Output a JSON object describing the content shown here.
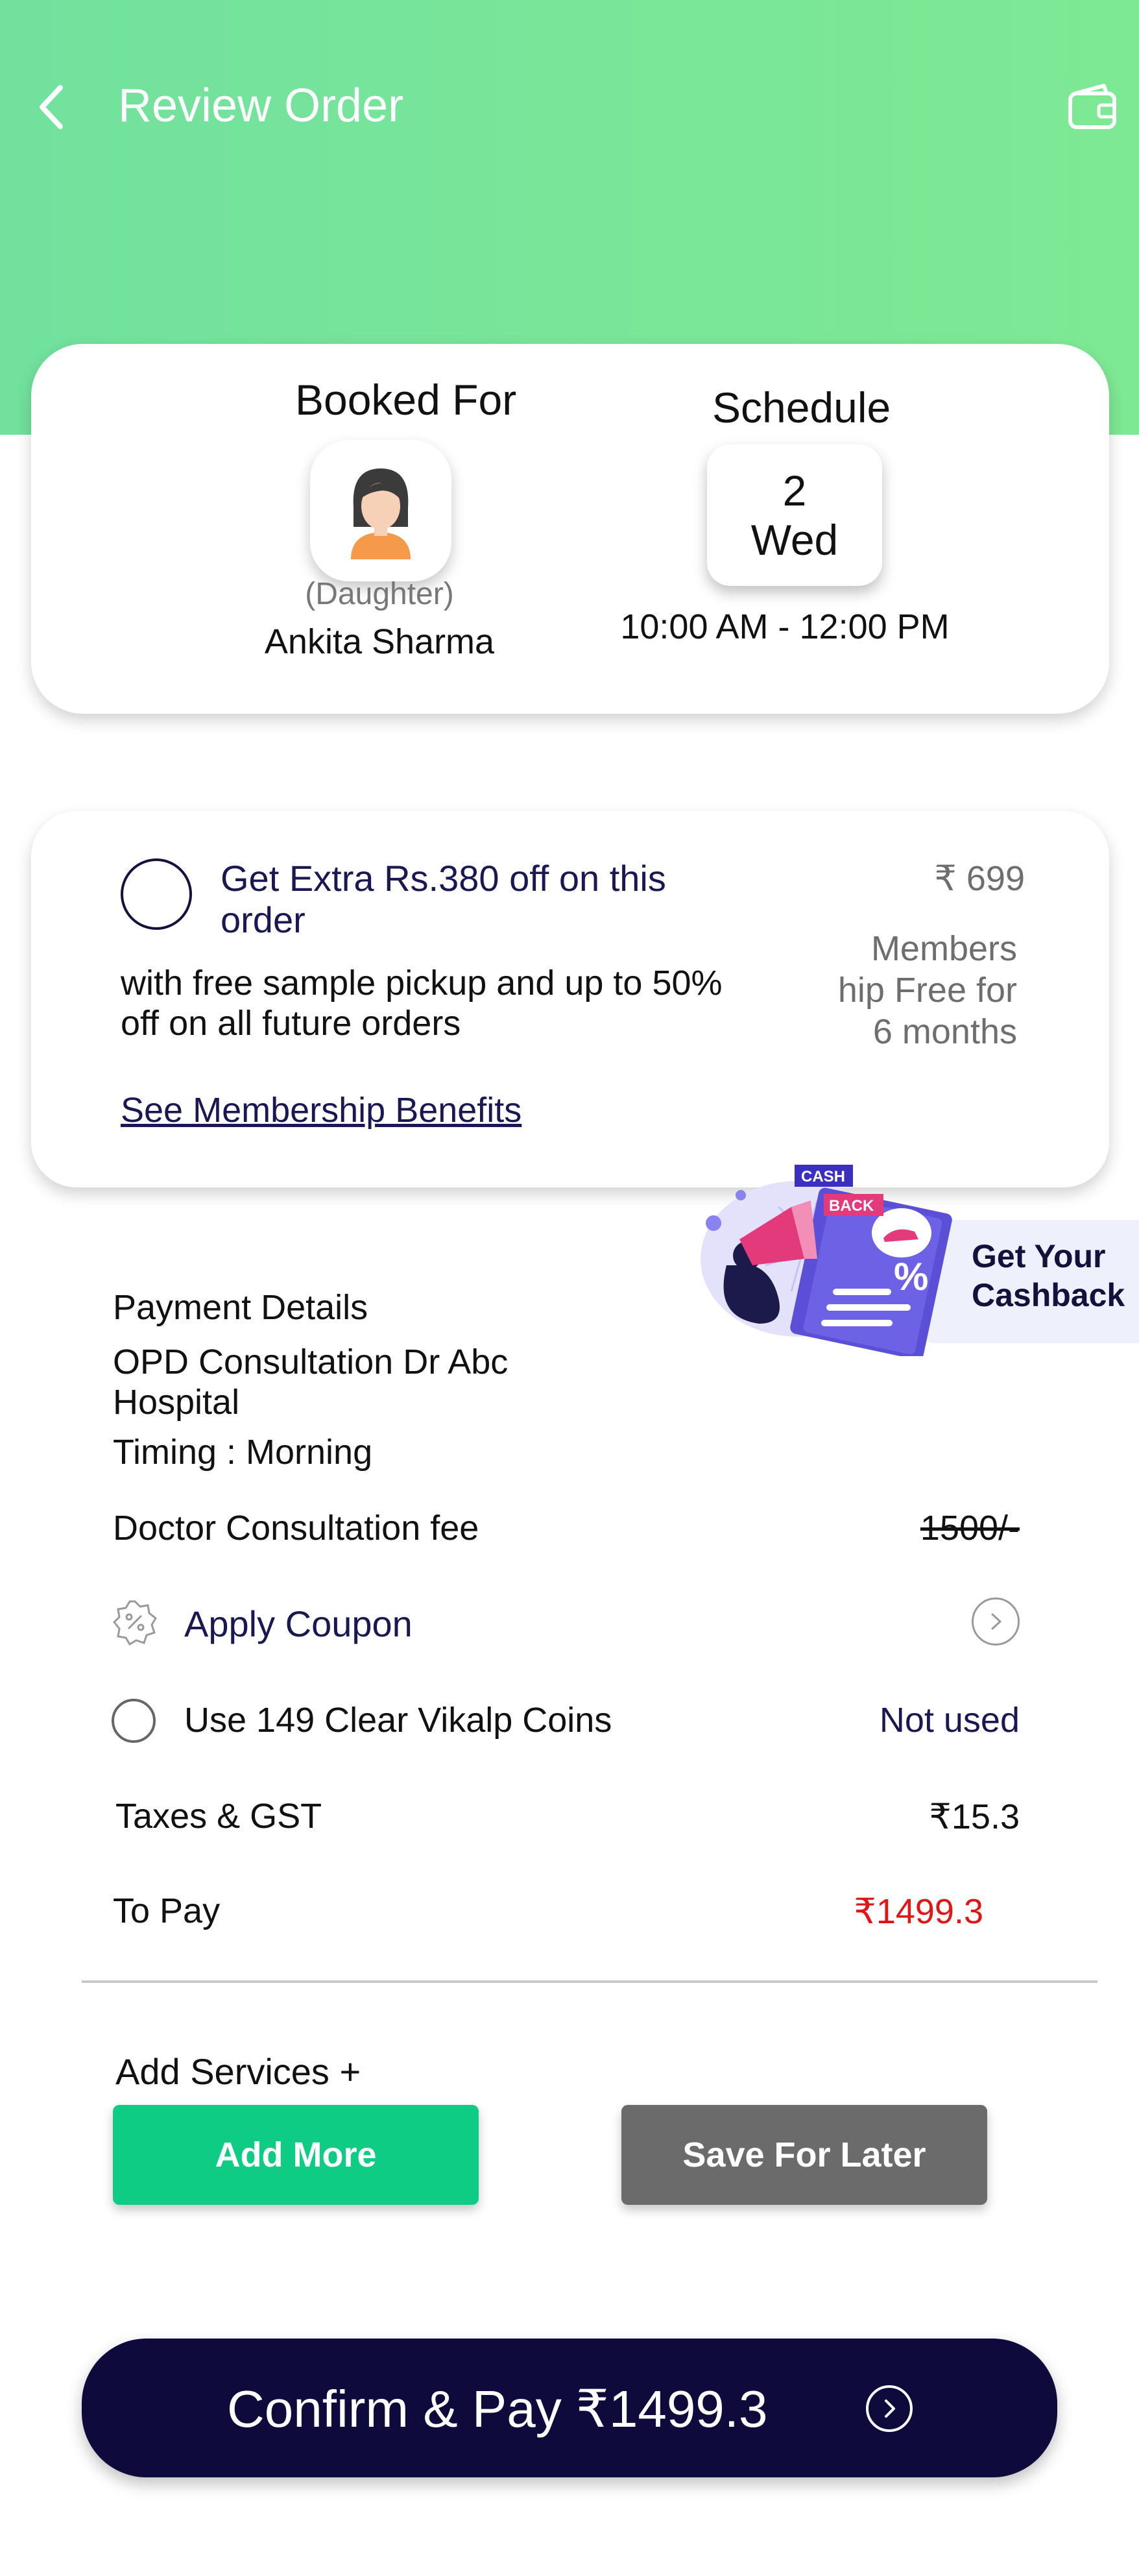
{
  "header": {
    "title": "Review Order",
    "back_icon": "chevron-left-icon",
    "wallet_icon": "wallet-icon"
  },
  "booking": {
    "booked_for_label": "Booked For",
    "relation": "(Daughter)",
    "patient_name": "Ankita Sharma",
    "schedule_label": "Schedule",
    "date_day": "2",
    "date_weekday": "Wed",
    "time_range": "10:00 AM - 12:00 PM"
  },
  "membership": {
    "offer_title": "Get Extra Rs.380 off on this order",
    "offer_description": "with free sample pickup and up to 50% off on all future orders",
    "price": "₹ 699",
    "note_line1": "Members",
    "note_line2": "hip Free for",
    "note_line3": "6 months",
    "benefits_link": "See Membership Benefits"
  },
  "cashback": {
    "badge_cash": "CASH",
    "badge_back": "BACK",
    "line1": "Get Your",
    "line2": "Cashback"
  },
  "payment": {
    "section_label": "Payment Details",
    "consultation": "OPD Consultation Dr Abc Hospital",
    "timing": "Timing : Morning",
    "fee_label": "Doctor Consultation fee",
    "fee_value": "1500/-",
    "coupon_label": "Apply Coupon",
    "coins_label": "Use 149 Clear Vikalp Coins",
    "coins_status": "Not used",
    "tax_label": "Taxes & GST",
    "tax_value": "₹15.3",
    "to_pay_label": "To Pay",
    "to_pay_value": "₹1499.3"
  },
  "services": {
    "label": "Add Services +",
    "add_more": "Add More",
    "save_later": "Save For Later"
  },
  "confirm": {
    "label": "Confirm & Pay ₹1499.3"
  },
  "colors": {
    "header_green": "#7ee994",
    "navy": "#0e0b3c",
    "add_button": "#0fcc85",
    "save_button": "#6b6b6b",
    "to_pay_red": "#e01616"
  }
}
